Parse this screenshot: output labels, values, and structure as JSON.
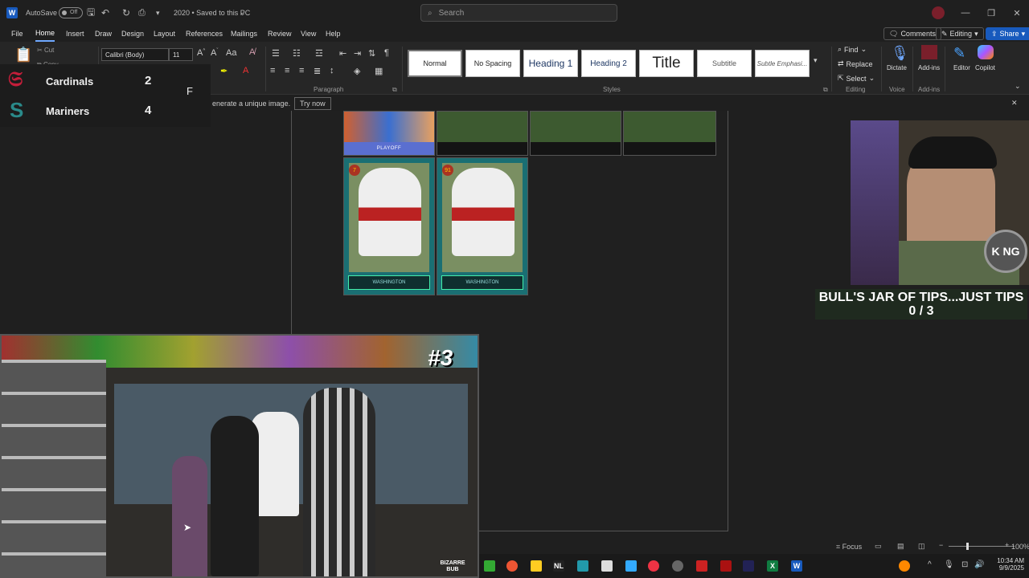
{
  "titlebar": {
    "autosave_label": "AutoSave",
    "autosave_state": "Off",
    "doc_title": "2020 • Saved to this PC",
    "search_placeholder": "Search"
  },
  "menu": {
    "items": [
      "File",
      "Home",
      "Insert",
      "Draw",
      "Design",
      "Layout",
      "References",
      "Mailings",
      "Review",
      "View",
      "Help"
    ],
    "active": "Home",
    "comments": "Comments",
    "editing": "Editing",
    "share": "Share"
  },
  "ribbon": {
    "clipboard": {
      "cut": "Cut",
      "copy": "Copy"
    },
    "font": {
      "name": "Calibri (Body)",
      "size": "11"
    },
    "paragraph_label": "Paragraph",
    "styles_label": "Styles",
    "styles": [
      "Normal",
      "No Spacing",
      "Heading 1",
      "Heading 2",
      "Title",
      "Subtitle",
      "Subtle Emphasi..."
    ],
    "editing": {
      "find": "Find",
      "replace": "Replace",
      "select": "Select",
      "label": "Editing"
    },
    "voice": {
      "dictate": "Dictate",
      "label": "Voice"
    },
    "addins": {
      "addins": "Add-ins",
      "label": "Add-ins"
    },
    "editor": "Editor",
    "copilot": "Copilot"
  },
  "infobar": {
    "message": "enerate a unique image.",
    "try_now": "Try now"
  },
  "scoreboard": {
    "teams": [
      {
        "name": "Cardinals",
        "score": "2"
      },
      {
        "name": "Mariners",
        "score": "4"
      }
    ],
    "status": "F"
  },
  "document": {
    "row1_labels": [
      "PLAYOFF",
      "",
      "",
      ""
    ],
    "cards": [
      {
        "number": "7",
        "team": "WASHINGTON"
      },
      {
        "number": "91",
        "team": "WASHINGTON"
      }
    ]
  },
  "overlay": {
    "tips_title": "BULL'S JAR OF TIPS...JUST TIPS",
    "tips_count": "0 / 3",
    "video_tag": "#3",
    "video_watermark": "BIZARRE BUB",
    "webcam_badge": "K NG"
  },
  "statusbar": {
    "focus": "Focus",
    "zoom": "100%"
  },
  "taskbar": {
    "time": "10:34 AM",
    "date": "9/9/2025"
  },
  "colors": {
    "accent": "#6fa8ff",
    "word_blue": "#185abd",
    "excel_green": "#107c41"
  }
}
